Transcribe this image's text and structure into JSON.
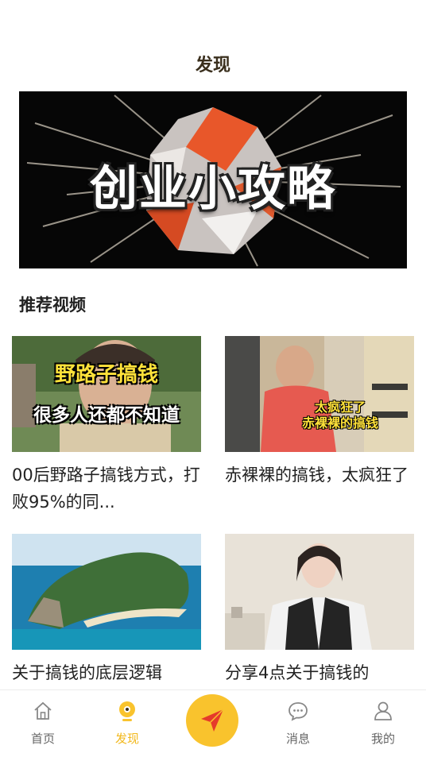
{
  "header": {
    "title": "发现"
  },
  "banner": {
    "title": "创业小攻略"
  },
  "section": {
    "title": "推荐视频"
  },
  "videos": [
    {
      "title": "00后野路子搞钱方式，打败95%的同...",
      "caption_line1": "野路子搞钱",
      "caption_line2": "很多人还都不知道"
    },
    {
      "title": "赤裸裸的搞钱，太疯狂了",
      "caption_line1": "太疯狂了",
      "caption_line2": "赤裸裸的搞钱"
    },
    {
      "title": "关于搞钱的底层逻辑"
    },
    {
      "title": "分享4点关于搞钱的"
    }
  ],
  "tabbar": {
    "items": [
      {
        "label": "首页",
        "icon": "home-icon"
      },
      {
        "label": "发现",
        "icon": "discover-icon",
        "active": true
      },
      {
        "label": "",
        "icon": "send-icon"
      },
      {
        "label": "消息",
        "icon": "message-icon"
      },
      {
        "label": "我的",
        "icon": "profile-icon"
      }
    ]
  },
  "colors": {
    "accent": "#f9c32d",
    "active_label": "#f2b81c",
    "send_arrow": "#e53a2b"
  }
}
